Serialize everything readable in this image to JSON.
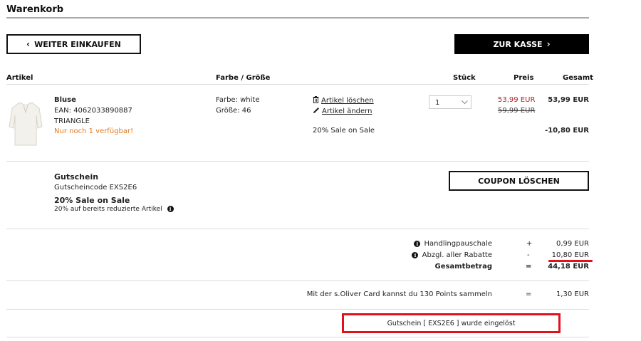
{
  "page": {
    "title": "Warenkorb"
  },
  "nav": {
    "continue_label": "WEITER EINKAUFEN",
    "checkout_label": "ZUR KASSE"
  },
  "table": {
    "headers": {
      "article": "Artikel",
      "color_size": "Farbe / Größe",
      "qty": "Stück",
      "price": "Preis",
      "total": "Gesamt"
    }
  },
  "item": {
    "name": "Bluse",
    "ean": "EAN: 4062033890887",
    "brand": "TRIANGLE",
    "availability": "Nur noch 1 verfügbar!",
    "color": "Farbe: white",
    "size": "Größe: 46",
    "delete_label": "Artikel löschen",
    "edit_label": "Artikel ändern",
    "discount_note": "20% Sale on Sale",
    "quantity": "1",
    "price_sale": "53,99 EUR",
    "price_original": "59,99 EUR",
    "total": "53,99 EUR",
    "discount_amount": "-10,80 EUR"
  },
  "coupon": {
    "heading": "Gutschein",
    "code_line": "Gutscheincode EXS2E6",
    "name": "20% Sale on Sale",
    "description": "20% auf bereits reduzierte Artikel",
    "delete_button": "COUPON LÖSCHEN"
  },
  "summary": {
    "handling_label": "Handlingpauschale",
    "handling_sign": "+",
    "handling_value": "0,99 EUR",
    "discount_label": "Abzgl. aller Rabatte",
    "discount_sign": "-",
    "discount_value": "10,80 EUR",
    "total_label": "Gesamtbetrag",
    "total_sign": "=",
    "total_value": "44,18 EUR"
  },
  "points": {
    "text": "Mit der s.Oliver Card kannst du 130 Points sammeln",
    "sign": "=",
    "value": "1,30 EUR"
  },
  "notice": {
    "text": "Gutschein [ EXS2E6 ] wurde eingelöst"
  },
  "colors": {
    "annotation_red": "#e3101c",
    "price_red": "#b01e23",
    "availability_orange": "#e07b20"
  }
}
